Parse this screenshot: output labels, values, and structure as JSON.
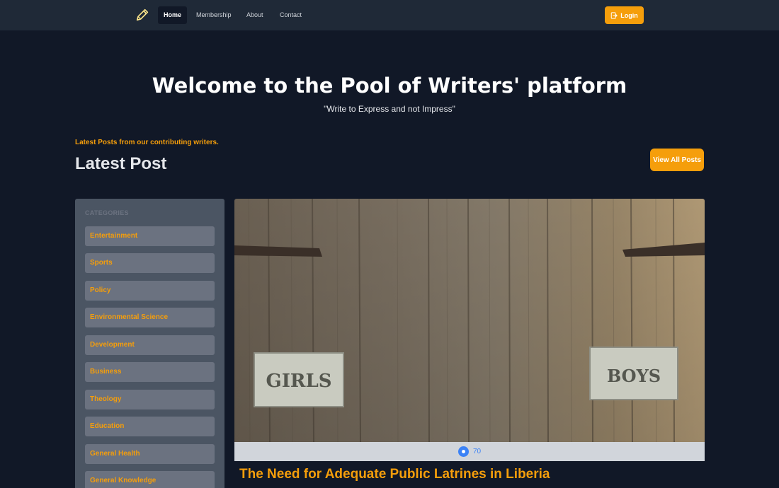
{
  "nav": {
    "items": [
      {
        "label": "Home",
        "active": true
      },
      {
        "label": "Membership",
        "active": false
      },
      {
        "label": "About",
        "active": false
      },
      {
        "label": "Contact",
        "active": false
      }
    ],
    "login_label": "Login",
    "logo_icon": "pencil-icon"
  },
  "hero": {
    "title": "Welcome to the Pool of Writers' platform",
    "subtitle": "\"Write to Express and not Impress\""
  },
  "latest": {
    "eyebrow": "Latest Posts from our contributing writers.",
    "title": "Latest Post",
    "view_all_label": "View All Posts"
  },
  "categories": {
    "heading": "CATEGORIES",
    "items": [
      "Entertainment",
      "Sports",
      "Policy",
      "Environmental Science",
      "Development",
      "Business",
      "Theology",
      "Education",
      "General Health",
      "General Knowledge"
    ]
  },
  "post": {
    "image_signs": [
      "GIRLS",
      "BOYS"
    ],
    "views": "70",
    "title": "The Need for Adequate Public Latrines in Liberia"
  },
  "colors": {
    "accent": "#f59e0b",
    "background": "#111827",
    "navbar": "#1f2937",
    "sidebar": "#4b5563",
    "category_item": "#6b7280"
  }
}
